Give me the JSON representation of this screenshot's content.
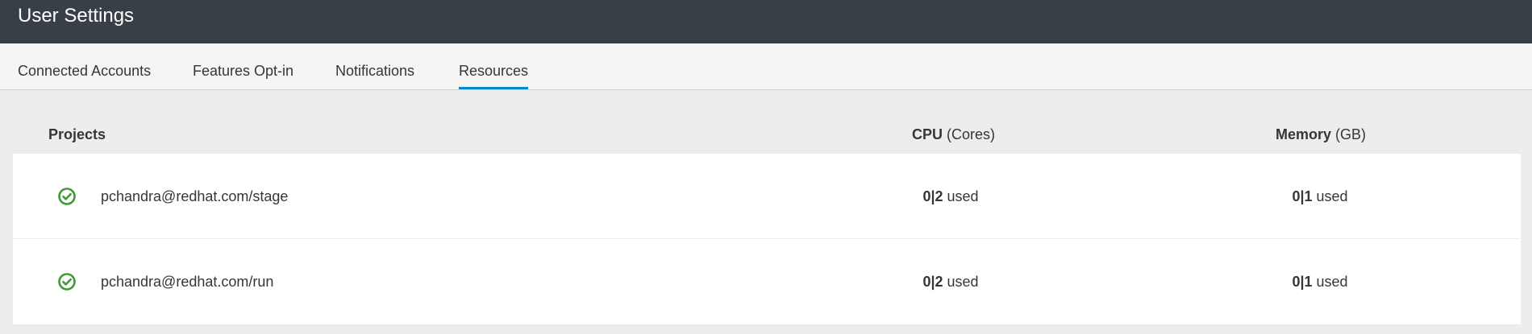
{
  "header": {
    "title": "User Settings"
  },
  "tabs": [
    {
      "label": "Connected Accounts",
      "active": false
    },
    {
      "label": "Features Opt-in",
      "active": false
    },
    {
      "label": "Notifications",
      "active": false
    },
    {
      "label": "Resources",
      "active": true
    }
  ],
  "table": {
    "columns": {
      "projects": "Projects",
      "cpu_bold": "CPU",
      "cpu_unit": "(Cores)",
      "memory_bold": "Memory",
      "memory_unit": "(GB)"
    },
    "rows": [
      {
        "status_icon": "check-circle-icon",
        "name": "pchandra@redhat.com/stage",
        "cpu_value": "0|2",
        "cpu_suffix": "used",
        "memory_value": "0|1",
        "memory_suffix": "used"
      },
      {
        "status_icon": "check-circle-icon",
        "name": "pchandra@redhat.com/run",
        "cpu_value": "0|2",
        "cpu_suffix": "used",
        "memory_value": "0|1",
        "memory_suffix": "used"
      }
    ]
  },
  "colors": {
    "header_bg": "#393f47",
    "active_tab_underline": "#0088ce",
    "status_ok": "#3f9c35"
  }
}
